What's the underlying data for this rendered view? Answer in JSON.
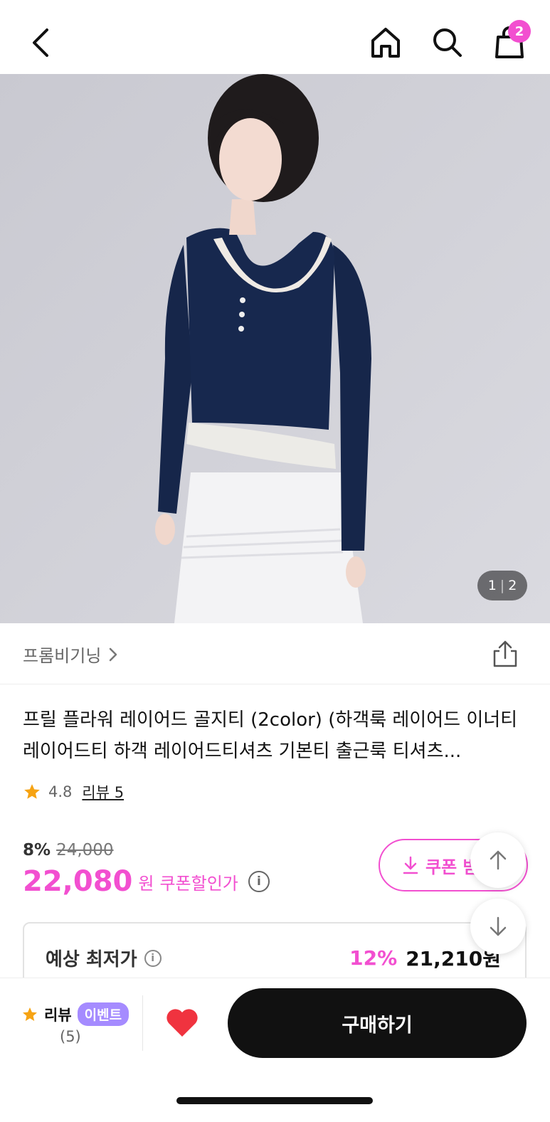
{
  "header": {
    "cart_count": "2"
  },
  "gallery": {
    "current": "1",
    "total": "2"
  },
  "brand": {
    "name": "프롬비기닝"
  },
  "product": {
    "title": "프릴 플라워 레이어드 골지티 (2color) (하객룩 레이어드 이너티 레이어드티 하객 레이어드티셔츠 기본티 출근룩 티셔츠...",
    "rating": "4.8",
    "review_label": "리뷰 5"
  },
  "pricing": {
    "discount_pct": "8%",
    "original_price": "24,000",
    "sale_price": "22,080",
    "currency": "원",
    "price_label": "쿠폰할인가",
    "coupon_button": "쿠폰 받"
  },
  "lowest": {
    "label": "예상 최저가",
    "pct": "12%",
    "price": "21,210원"
  },
  "bottom": {
    "review_label": "리뷰",
    "event_badge": "이벤트",
    "review_count": "(5)",
    "buy_button": "구매하기"
  },
  "colors": {
    "accent": "#f24fd0",
    "event": "#a58bff",
    "heart": "#f0333f",
    "star": "#f6a313"
  }
}
